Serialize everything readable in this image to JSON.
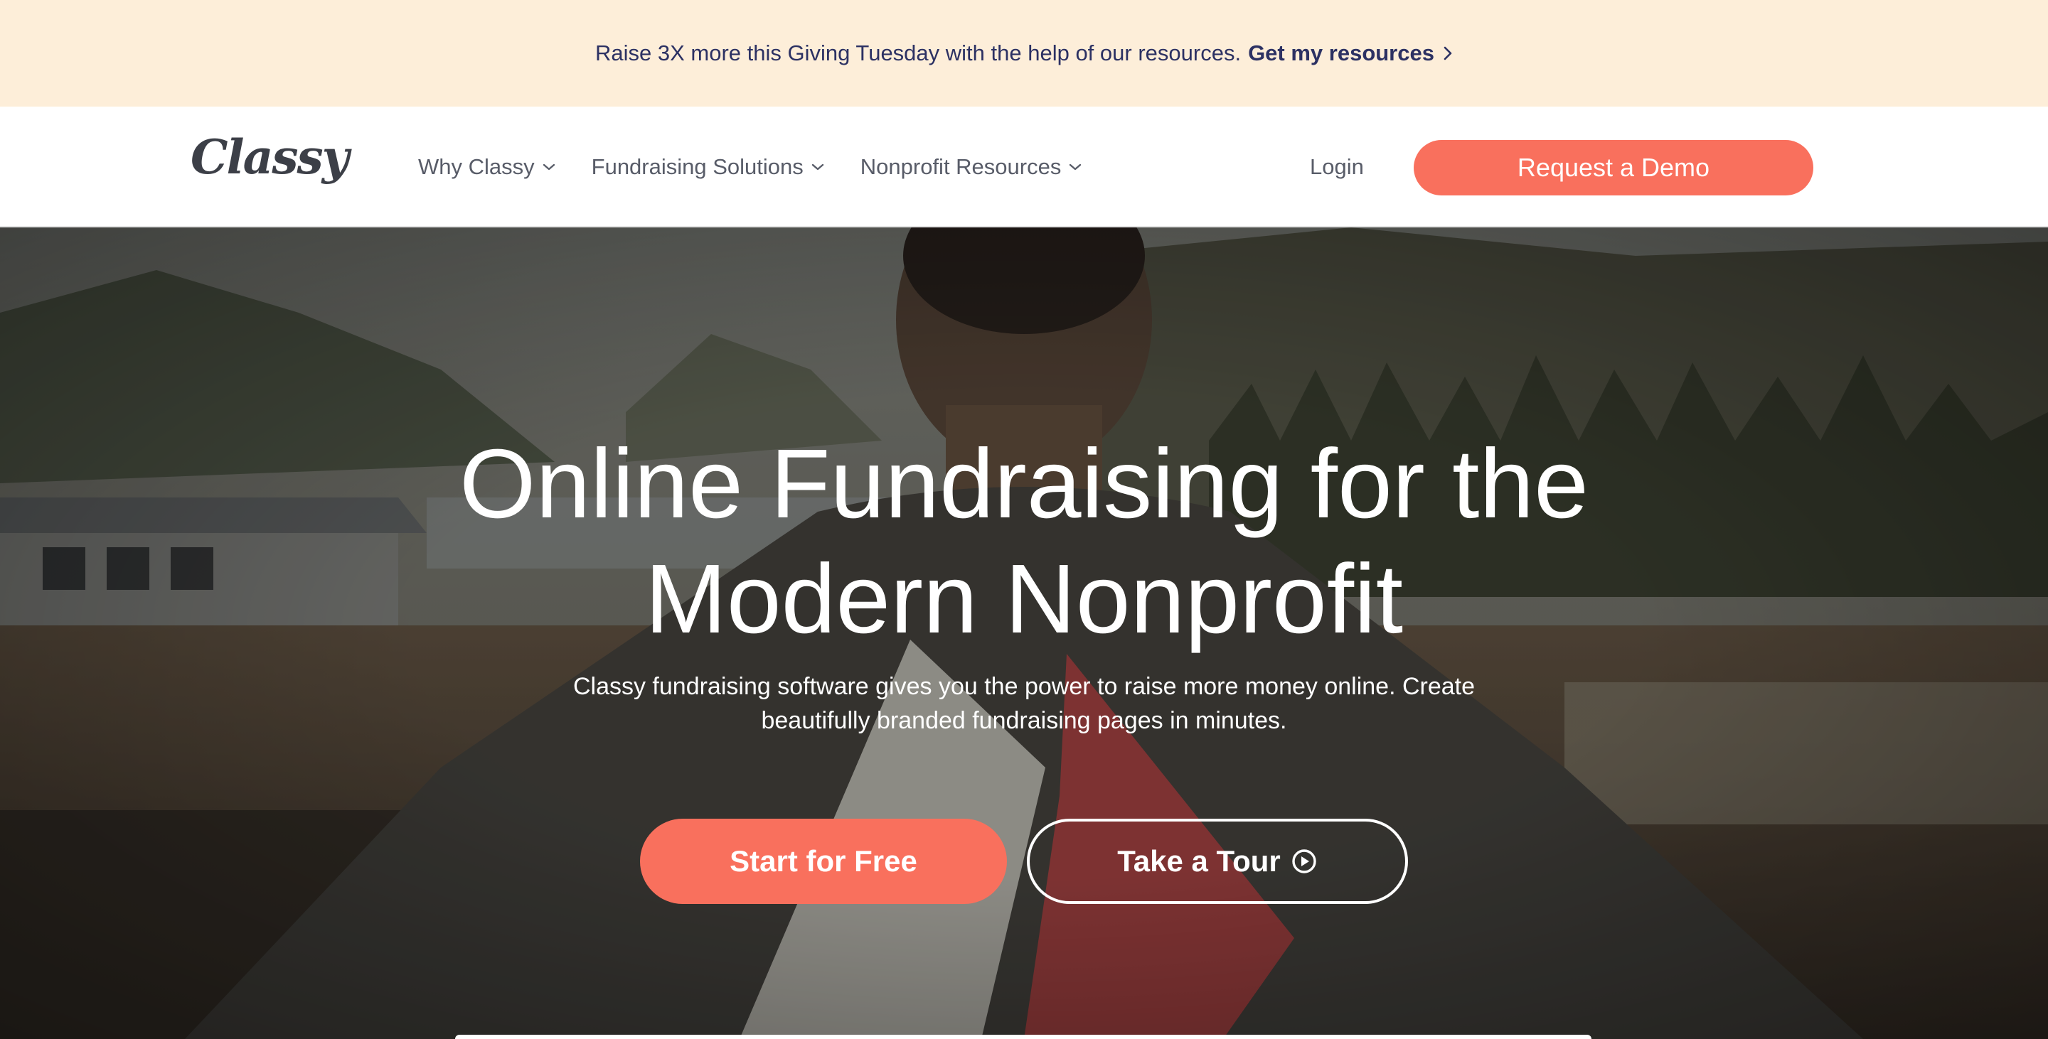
{
  "promo": {
    "text": "Raise 3X more this Giving Tuesday with the help of our resources.",
    "cta_label": "Get my resources"
  },
  "nav": {
    "logo": "Classy",
    "menu": [
      {
        "label": "Why Classy"
      },
      {
        "label": "Fundraising Solutions"
      },
      {
        "label": "Nonprofit Resources"
      }
    ],
    "login_label": "Login",
    "demo_label": "Request a Demo"
  },
  "hero": {
    "title_line1": "Online Fundraising for the",
    "title_line2": "Modern Nonprofit",
    "subtitle_line1": "Classy fundraising software gives you the power to raise more money online. Create",
    "subtitle_line2": "beautifully branded fundraising pages in minutes.",
    "primary_cta": "Start for Free",
    "secondary_cta": "Take a Tour"
  },
  "colors": {
    "promo_bg": "#fdeed9",
    "promo_text": "#2c3163",
    "accent": "#f9705d",
    "nav_text": "#585c68",
    "logo": "#3c3f47"
  },
  "icons": {
    "promo_cta": "chevron-right-icon",
    "menu_dropdown": "chevron-down-icon",
    "tour": "play-circle-icon"
  }
}
